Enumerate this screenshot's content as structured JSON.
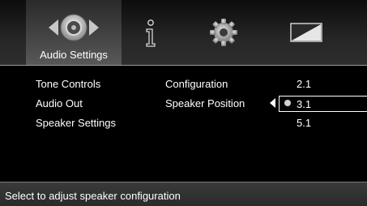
{
  "tabs": [
    {
      "label": "Audio Settings",
      "icon": "speaker-icon",
      "active": true
    },
    {
      "label": "",
      "icon": "info-icon",
      "active": false
    },
    {
      "label": "",
      "icon": "gear-icon",
      "active": false
    },
    {
      "label": "",
      "icon": "display-icon",
      "active": false
    }
  ],
  "menu": {
    "column1": [
      "Tone Controls",
      "Audio Out",
      "Speaker Settings"
    ],
    "column2": [
      "Configuration",
      "Speaker Position"
    ],
    "column3": {
      "options": [
        "2.1",
        "3.1",
        "5.1"
      ],
      "selected": "3.1"
    }
  },
  "status": {
    "hint": "Select to adjust speaker configuration"
  },
  "colors": {
    "background": "#000000",
    "text": "#ffffff",
    "highlight_border": "#ffffff"
  }
}
